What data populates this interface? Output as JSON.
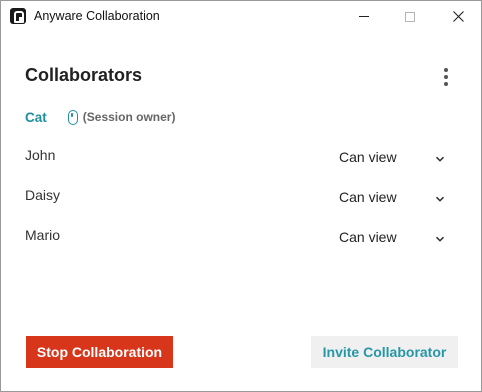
{
  "window": {
    "title": "Anyware Collaboration",
    "controls": {
      "minimize": "minimize",
      "maximize": "maximize",
      "close": "close"
    }
  },
  "header": {
    "title": "Collaborators",
    "menu_icon": "more-vertical-icon"
  },
  "owner": {
    "name": "Cat",
    "role": "(Session owner)",
    "icon": "mouse-icon"
  },
  "collaborators": [
    {
      "name": "John",
      "permission": "Can view"
    },
    {
      "name": "Daisy",
      "permission": "Can view"
    },
    {
      "name": "Mario",
      "permission": "Can view"
    }
  ],
  "footer": {
    "stop_label": "Stop Collaboration",
    "invite_label": "Invite Collaborator"
  },
  "colors": {
    "accent": "#1f8ea0",
    "danger": "#d8361b",
    "secondary_bg": "#f0f0f0"
  }
}
